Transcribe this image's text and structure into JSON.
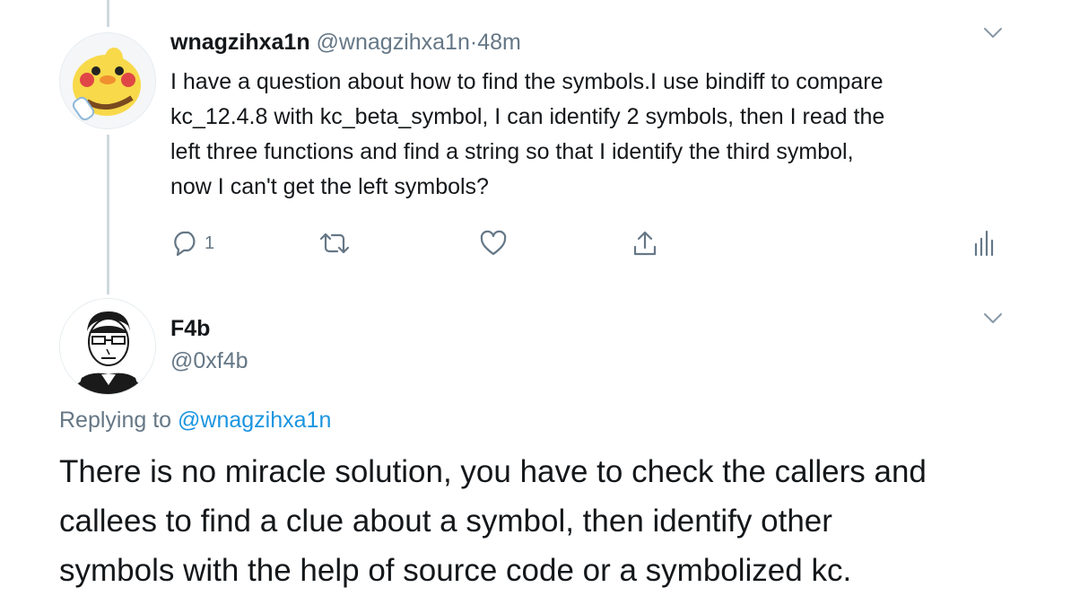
{
  "tweet1": {
    "display_name": "wnagzihxa1n",
    "handle": "@wnagzihxa1n",
    "separator": "·",
    "time": "48m",
    "text": "I have a question about how to find the symbols.I use bindiff to compare\nkc_12.4.8 with kc_beta_symbol, I can identify 2 symbols, then I read the\nleft three functions and find a string so that I identify the third symbol,\nnow I can't get the left symbols?",
    "reply_count": "1",
    "avatar": "cartoon-chick-avatar"
  },
  "tweet2": {
    "display_name": "F4b",
    "handle": "@0xf4b",
    "replying_prefix": "Replying to ",
    "replying_to": "@wnagzihxa1n",
    "text": "There is no miracle solution, you have to check the callers and\ncallees to find a clue about a symbol, then identify other\nsymbols with the help of source code or a symbolized kc.",
    "avatar": "man-with-glasses-sketch-avatar"
  },
  "icons": {
    "reply": "speech-bubble-icon",
    "retweet": "retweet-arrows-icon",
    "like": "heart-icon",
    "share": "share-upload-icon",
    "analytics": "bar-chart-icon",
    "menu": "chevron-down-icon"
  },
  "colors": {
    "text": "#14171a",
    "secondary": "#657786",
    "link": "#1b95e0",
    "thread_line": "#cfd9de"
  }
}
